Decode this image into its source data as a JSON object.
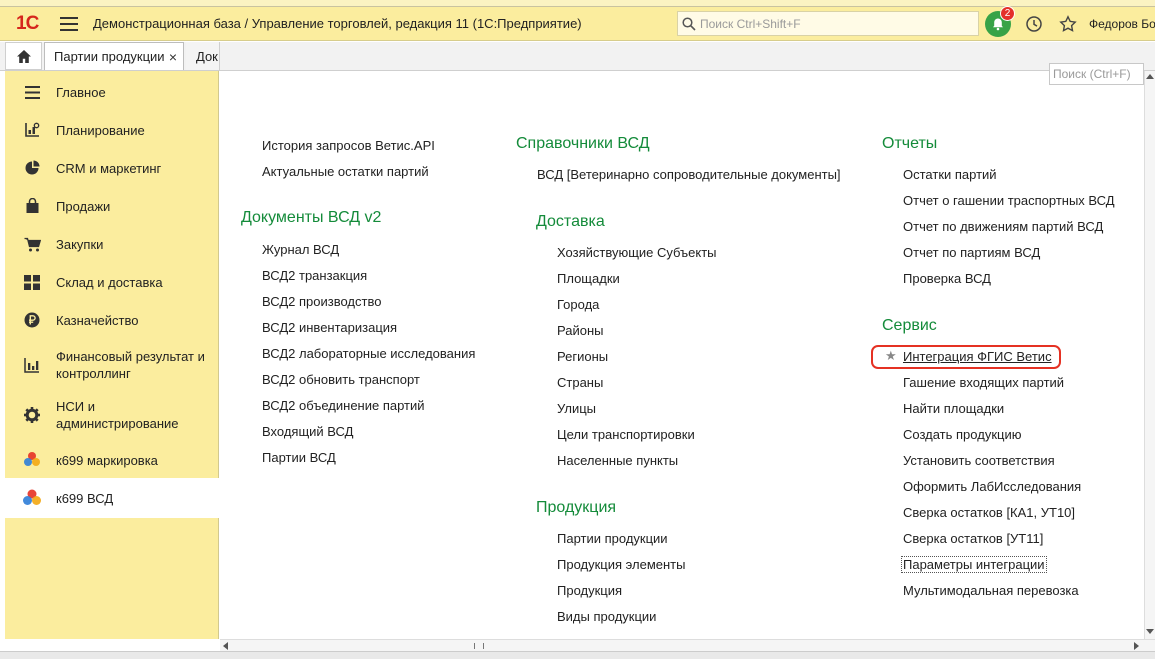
{
  "app": {
    "title": "Демонстрационная база / Управление торговлей, редакция 11  (1С:Предприятие)",
    "logo": "1С",
    "search_placeholder": "Поиск Ctrl+Shift+F",
    "notifications_count": "2",
    "user": "Федоров Бо"
  },
  "tabs": {
    "active": "Партии продукции",
    "next": "Док"
  },
  "sidebar": [
    {
      "label": "Главное",
      "icon": "menu-lines-icon"
    },
    {
      "label": "Планирование",
      "icon": "planning-chart-icon"
    },
    {
      "label": "CRM и маркетинг",
      "icon": "pie-chart-icon"
    },
    {
      "label": "Продажи",
      "icon": "shopping-bag-icon"
    },
    {
      "label": "Закупки",
      "icon": "cart-icon"
    },
    {
      "label": "Склад и доставка",
      "icon": "warehouse-grid-icon"
    },
    {
      "label": "Казначейство",
      "icon": "ruble-coin-icon"
    },
    {
      "label": "Финансовый результат и контроллинг",
      "icon": "bar-chart-icon"
    },
    {
      "label": "НСИ и администрирование",
      "icon": "gear-icon"
    },
    {
      "label": "к699 маркировка",
      "icon": "k699-logo-icon"
    },
    {
      "label": "к699 ВСД",
      "icon": "k699-logo-icon"
    }
  ],
  "content": {
    "search_placeholder": "Поиск (Ctrl+F)",
    "col1": {
      "top_links": [
        "История запросов Ветис.API",
        "Актуальные остатки партий"
      ],
      "group_title": "Документы ВСД v2",
      "links": [
        "Журнал ВСД",
        "ВСД2 транзакция",
        "ВСД2 производство",
        "ВСД2 инвентаризация",
        "ВСД2 лабораторные исследования",
        "ВСД2 обновить транспорт",
        "ВСД2 объединение партий",
        "Входящий ВСД",
        "Партии ВСД"
      ]
    },
    "col2": {
      "groups": [
        {
          "title": "Справочники ВСД",
          "links": [
            "ВСД [Ветеринарно сопроводительные документы]"
          ]
        },
        {
          "title": "Доставка",
          "links": [
            "Хозяйствующие Субъекты",
            "Площадки",
            "Города",
            "Районы",
            "Регионы",
            "Страны",
            "Улицы",
            "Цели транспортировки",
            "Населенные пункты"
          ]
        },
        {
          "title": "Продукция",
          "links": [
            "Партии продукции",
            "Продукция элементы",
            "Продукция",
            "Виды продукции"
          ]
        }
      ]
    },
    "col3": {
      "groups": [
        {
          "title": "Отчеты",
          "links": [
            "Остатки партий",
            "Отчет о гашении траспортных ВСД",
            "Отчет по движениям партий ВСД",
            "Отчет по партиям ВСД",
            "Проверка ВСД"
          ]
        },
        {
          "title": "Сервис",
          "links": [
            "Интеграция ФГИС Ветис",
            "Гашение входящих партий",
            "Найти площадки",
            "Создать продукцию",
            "Установить соответствия",
            "Оформить ЛабИсследования",
            "Сверка остатков [КА1, УТ10]",
            "Сверка остатков [УТ11]",
            "Параметры интеграции",
            "Мультимодальная перевозка"
          ]
        }
      ]
    },
    "highlight_color": "#e53123",
    "group_color": "#148b3a"
  }
}
